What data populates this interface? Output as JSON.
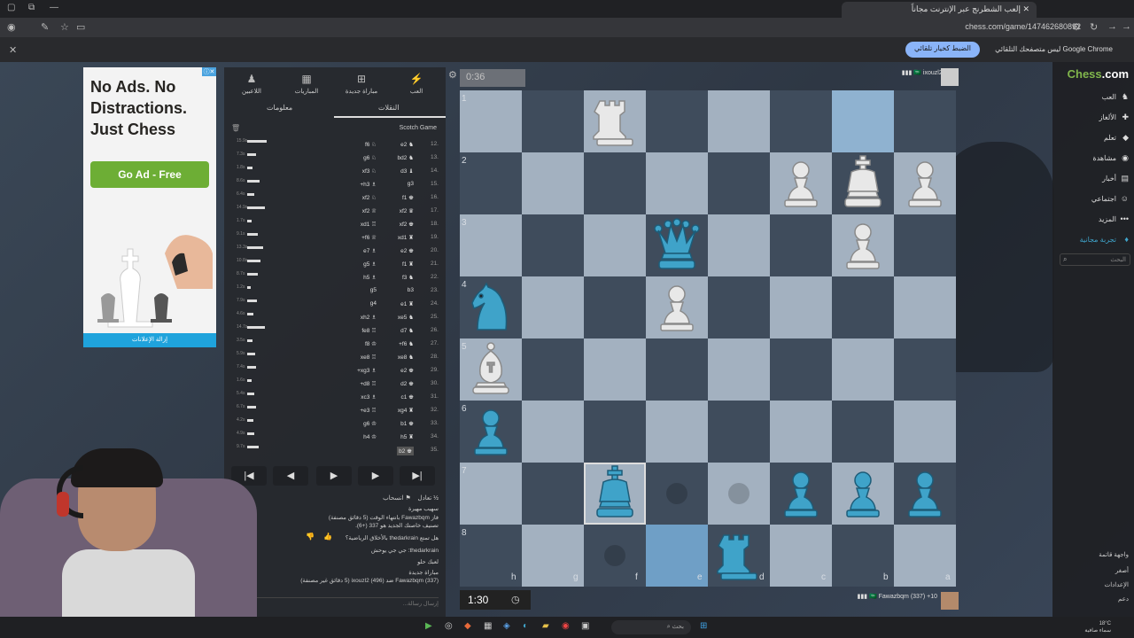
{
  "browser": {
    "tab_title": "إلعب الشطرنج عبر الإنترنت مجاناً",
    "url": "chess.com/game/147462680892",
    "info_text": "Google Chrome ليس متصفحك التلقائي",
    "info_button": "الضبط كخيار تلقائي"
  },
  "ad": {
    "title": "No Ads. No Distractions. Just Chess",
    "button": "Go Ad - Free",
    "footer": "إزالة الإعلانات",
    "close": "ⓘ✕"
  },
  "panel": {
    "tabs": [
      {
        "label": "العب",
        "icon": "bolt-icon"
      },
      {
        "label": "مباراة جديدة",
        "icon": "plus-icon"
      },
      {
        "label": "المباريات",
        "icon": "board-icon"
      },
      {
        "label": "اللاعبين",
        "icon": "players-icon"
      }
    ],
    "subtabs": {
      "moves": "النقلات",
      "info": "معلومات"
    },
    "opening": "Scotch Game",
    "moves": [
      {
        "num": "12.",
        "white": "e2 ♞",
        "black": "f6 ♘"
      },
      {
        "num": "13.",
        "white": "bd2 ♞",
        "black": "g6 ♘"
      },
      {
        "num": "14.",
        "white": "d3 ♝",
        "black": "xf3 ♘"
      },
      {
        "num": "15.",
        "white": "g3",
        "black": "+h3 ♗"
      },
      {
        "num": "16.",
        "white": "f1 ♚",
        "black": "xf2 ♘"
      },
      {
        "num": "17.",
        "white": "xf2 ♛",
        "black": "xf2 ♕"
      },
      {
        "num": "18.",
        "white": "xf2 ♚",
        "black": "xd1 ♖"
      },
      {
        "num": "19.",
        "white": "xd1 ♜",
        "black": "+f6 ♕"
      },
      {
        "num": "20.",
        "white": "e2 ♚",
        "black": "e7 ♗"
      },
      {
        "num": "21.",
        "white": "f1 ♜",
        "black": "g5 ♗"
      },
      {
        "num": "22.",
        "white": "f3 ♞",
        "black": "h5 ♗"
      },
      {
        "num": "23.",
        "white": "b3",
        "black": "g5"
      },
      {
        "num": "24.",
        "white": "e1 ♜",
        "black": "g4"
      },
      {
        "num": "25.",
        "white": "xe5 ♞",
        "black": "xh2 ♗"
      },
      {
        "num": "26.",
        "white": "d7 ♞",
        "black": "fe8 ♖"
      },
      {
        "num": "27.",
        "white": "+f6 ♞",
        "black": "f8 ♔"
      },
      {
        "num": "28.",
        "white": "xe8 ♞",
        "black": "xe8 ♖"
      },
      {
        "num": "29.",
        "white": "e2 ♚",
        "black": "+xg3 ♗"
      },
      {
        "num": "30.",
        "white": "d2 ♚",
        "black": "+d8 ♖"
      },
      {
        "num": "31.",
        "white": "c1 ♚",
        "black": "xc3 ♗"
      },
      {
        "num": "32.",
        "white": "xg4 ♜",
        "black": "+e3 ♖"
      },
      {
        "num": "33.",
        "white": "b1 ♚",
        "black": "g6 ♔"
      },
      {
        "num": "34.",
        "white": "h5 ♜",
        "black": "h4 ♔"
      },
      {
        "num": "35.",
        "white": "b2 ♚",
        "black": ""
      }
    ],
    "times": [
      "15.9s",
      "7.3s",
      "1.8s",
      "8.6s",
      "6.4s",
      "14.9s",
      "1.7s",
      "9.1s",
      "13.3s",
      "10.8s",
      "8.7s",
      "1.2s",
      "7.9s",
      "4.6s",
      "14.7s",
      "3.5s",
      "5.9s",
      "7.4s",
      "1.6s",
      "5.4s",
      "6.7s",
      "4.2s",
      "4.9s",
      "9.7s"
    ],
    "controls": {
      "first": "|◀",
      "prev": "◀",
      "play": "▶",
      "next": "▶",
      "last": "▶|"
    },
    "actions": {
      "draw": "½ تعادل",
      "resign": "⚑ انسحاب"
    }
  },
  "chat": [
    "سهيب مهيرة",
    "فاز Fawazbqm بانتهاء الوقت (5 دقائق مصنفة)",
    "تصنيف خاصتك الجديد هو 337 (+6).",
    "هل تمتع thedarkrain بالأخلاق الرياضية؟",
    "thedarkrain: جي جي يوحش",
    "لعبك حلو",
    "مباراة جديدة",
    "Fawazbqm (337) ضد ixouzl2 (496) (5 دقائق غير مصنفة)"
  ],
  "chat_placeholder": "إرسال رسالة...",
  "game": {
    "top_timer": "0:36",
    "bottom_timer": "1:30",
    "top_player": "ixouzl2 (496)",
    "bottom_player": "Fawazbqm (337)",
    "bottom_extra": "+10",
    "ranks": [
      "1",
      "2",
      "3",
      "4",
      "5",
      "6",
      "7",
      "8"
    ],
    "files": [
      "h",
      "g",
      "f",
      "e",
      "d",
      "c",
      "b",
      "a"
    ],
    "pieces": [
      {
        "sq": [
          0,
          2
        ],
        "type": "rook",
        "color": "white"
      },
      {
        "sq": [
          1,
          5
        ],
        "type": "pawn",
        "color": "white"
      },
      {
        "sq": [
          1,
          6
        ],
        "type": "king",
        "color": "white"
      },
      {
        "sq": [
          1,
          7
        ],
        "type": "pawn",
        "color": "white"
      },
      {
        "sq": [
          2,
          3
        ],
        "type": "queen",
        "color": "blue"
      },
      {
        "sq": [
          2,
          6
        ],
        "type": "pawn",
        "color": "white"
      },
      {
        "sq": [
          3,
          0
        ],
        "type": "knight",
        "color": "blue"
      },
      {
        "sq": [
          3,
          3
        ],
        "type": "pawn",
        "color": "white"
      },
      {
        "sq": [
          4,
          0
        ],
        "type": "bishop",
        "color": "white"
      },
      {
        "sq": [
          5,
          0
        ],
        "type": "pawn",
        "color": "blue"
      },
      {
        "sq": [
          6,
          2
        ],
        "type": "king",
        "color": "blue"
      },
      {
        "sq": [
          6,
          5
        ],
        "type": "pawn",
        "color": "blue"
      },
      {
        "sq": [
          6,
          6
        ],
        "type": "pawn",
        "color": "blue"
      },
      {
        "sq": [
          6,
          7
        ],
        "type": "pawn",
        "color": "blue"
      },
      {
        "sq": [
          7,
          4
        ],
        "type": "rook",
        "color": "blue"
      }
    ],
    "colors": {
      "light": "#a3b1c0",
      "dark": "#3f4c5c",
      "blue": "#3fa3c9",
      "white": "#e8e8e8"
    }
  },
  "sidebar": {
    "logo_a": "Chess",
    "logo_b": ".com",
    "items": [
      {
        "label": "العب",
        "icon": "play-icon"
      },
      {
        "label": "الألغاز",
        "icon": "puzzle-icon"
      },
      {
        "label": "تعلم",
        "icon": "learn-icon"
      },
      {
        "label": "مشاهدة",
        "icon": "watch-icon"
      },
      {
        "label": "أخبار",
        "icon": "news-icon"
      },
      {
        "label": "اجتماعي",
        "icon": "social-icon"
      },
      {
        "label": "المزيد",
        "icon": "more-icon"
      },
      {
        "label": "تجربة مجانية",
        "icon": "diamond-icon"
      }
    ],
    "search_placeholder": "البحث",
    "footer": [
      "واجهة قاتمة",
      "أصغر",
      "الإعدادات",
      "دعم"
    ]
  },
  "taskbar": {
    "search": "بحث",
    "weather": "18°C",
    "weather_desc": "سماء صافية"
  }
}
